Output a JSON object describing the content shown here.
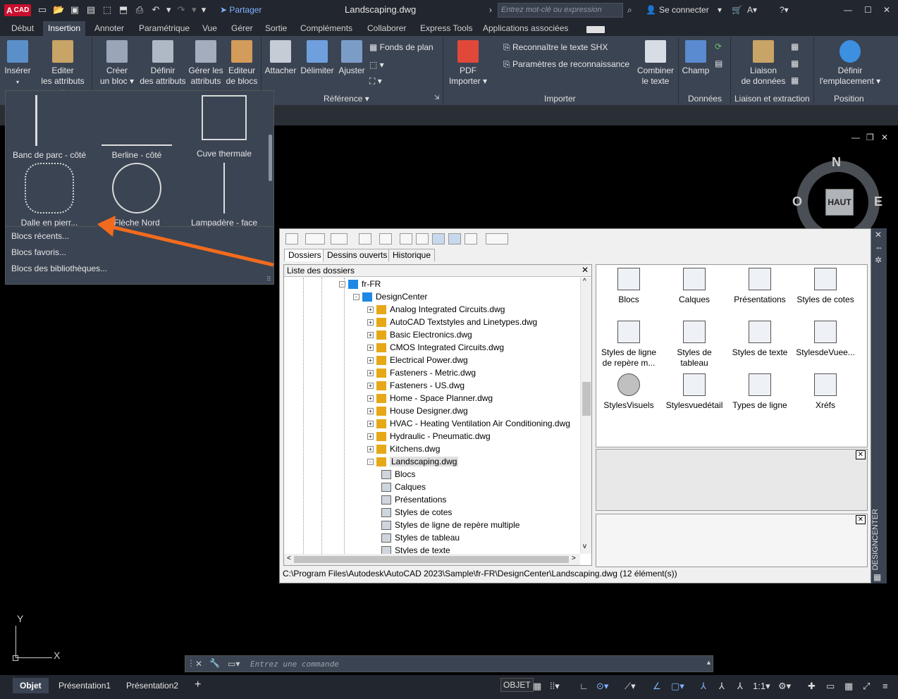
{
  "app": {
    "logo_a": "A",
    "logo_text": "CAD",
    "share": "Partager",
    "title": "Landscaping.dwg",
    "search_placeholder": "Entrez mot-clé ou expression",
    "signin": "Se connecter"
  },
  "tabs": [
    "Début",
    "Insertion",
    "Annoter",
    "Paramétrique",
    "Vue",
    "Gérer",
    "Sortie",
    "Compléments",
    "Collaborer",
    "Express Tools",
    "Applications associées"
  ],
  "ribbon": {
    "insert": "Insérer",
    "edit_attr_1": "Editer",
    "edit_attr_2": "les attributs",
    "create_block_1": "Créer",
    "create_block_2": "un bloc",
    "define_attr_1": "Définir",
    "define_attr_2": "des attributs",
    "manage_attr_1": "Gérer les",
    "manage_attr_2": "attributs",
    "block_editor_1": "Editeur",
    "block_editor_2": "de blocs",
    "attach": "Attacher",
    "clip": "Délimiter",
    "adjust": "Ajuster",
    "underlay": "Fonds de plan",
    "reference_panel": "Référence",
    "pdf_import_1": "PDF",
    "pdf_import_2": "Importer",
    "shx_recognize": "Reconnaître le texte SHX",
    "recog_settings": "Paramètres de reconnaissance",
    "combine_text_1": "Combiner",
    "combine_text_2": "le texte",
    "import_panel": "Importer",
    "field": "Champ",
    "data_panel": "Données",
    "data_link_1": "Liaison",
    "data_link_2": "de données",
    "link_panel": "Liaison et extraction",
    "set_location_1": "Définir",
    "set_location_2": "l'emplacement",
    "position_panel": "Position"
  },
  "gallery": {
    "items": [
      "Banc de parc - côté",
      "Berline - côté",
      "Cuve thermale",
      "Dalle en pierr...",
      "Flèche Nord",
      "Lampadère - face"
    ],
    "menu": [
      "Blocs récents...",
      "Blocs favoris...",
      "Blocs des bibliothèques..."
    ]
  },
  "viewcube": {
    "n": "N",
    "o": "O",
    "e": "E",
    "top": "HAUT"
  },
  "dc": {
    "tabs": [
      "Dossiers",
      "Dessins ouverts",
      "Historique"
    ],
    "folder_list": "Liste des dossiers",
    "tree": [
      {
        "label": "fr-FR",
        "level": 0,
        "exp": "-"
      },
      {
        "label": "DesignCenter",
        "level": 1,
        "exp": "-"
      },
      {
        "label": "Analog Integrated Circuits.dwg",
        "level": 2,
        "exp": "+"
      },
      {
        "label": "AutoCAD Textstyles and Linetypes.dwg",
        "level": 2,
        "exp": "+"
      },
      {
        "label": "Basic Electronics.dwg",
        "level": 2,
        "exp": "+"
      },
      {
        "label": "CMOS Integrated Circuits.dwg",
        "level": 2,
        "exp": "+"
      },
      {
        "label": "Electrical Power.dwg",
        "level": 2,
        "exp": "+"
      },
      {
        "label": "Fasteners - Metric.dwg",
        "level": 2,
        "exp": "+"
      },
      {
        "label": "Fasteners - US.dwg",
        "level": 2,
        "exp": "+"
      },
      {
        "label": "Home - Space Planner.dwg",
        "level": 2,
        "exp": "+"
      },
      {
        "label": "House Designer.dwg",
        "level": 2,
        "exp": "+"
      },
      {
        "label": "HVAC - Heating Ventilation Air Conditioning.dwg",
        "level": 2,
        "exp": "+"
      },
      {
        "label": "Hydraulic - Pneumatic.dwg",
        "level": 2,
        "exp": "+"
      },
      {
        "label": "Kitchens.dwg",
        "level": 2,
        "exp": "+"
      },
      {
        "label": "Landscaping.dwg",
        "level": 2,
        "exp": "-"
      },
      {
        "label": "Blocs",
        "level": 3,
        "exp": ""
      },
      {
        "label": "Calques",
        "level": 3,
        "exp": ""
      },
      {
        "label": "Présentations",
        "level": 3,
        "exp": ""
      },
      {
        "label": "Styles de cotes",
        "level": 3,
        "exp": ""
      },
      {
        "label": "Styles de ligne de repère multiple",
        "level": 3,
        "exp": ""
      },
      {
        "label": "Styles de tableau",
        "level": 3,
        "exp": ""
      },
      {
        "label": "Styles de texte",
        "level": 3,
        "exp": ""
      }
    ],
    "icons": [
      {
        "l1": "Blocs",
        "l2": ""
      },
      {
        "l1": "Calques",
        "l2": ""
      },
      {
        "l1": "Présentations",
        "l2": ""
      },
      {
        "l1": "Styles de cotes",
        "l2": ""
      },
      {
        "l1": "Styles de ligne",
        "l2": "de repère m..."
      },
      {
        "l1": "Styles de tableau",
        "l2": ""
      },
      {
        "l1": "Styles de texte",
        "l2": ""
      },
      {
        "l1": "StylesdeVuee...",
        "l2": ""
      },
      {
        "l1": "StylesVisuels",
        "l2": ""
      },
      {
        "l1": "Stylesvuedétail",
        "l2": ""
      },
      {
        "l1": "Types de ligne",
        "l2": ""
      },
      {
        "l1": "Xréfs",
        "l2": ""
      }
    ],
    "status": "C:\\Program Files\\Autodesk\\AutoCAD 2023\\Sample\\fr-FR\\DesignCenter\\Landscaping.dwg (12 élément(s))",
    "side_title": "DESIGNCENTER"
  },
  "ucs": {
    "y": "Y",
    "x": "X"
  },
  "command": {
    "placeholder": "Entrez une commande"
  },
  "layout_tabs": [
    "Objet",
    "Présentation1",
    "Présentation2"
  ],
  "status_bar": {
    "model": "OBJET",
    "scale": "1:1"
  }
}
